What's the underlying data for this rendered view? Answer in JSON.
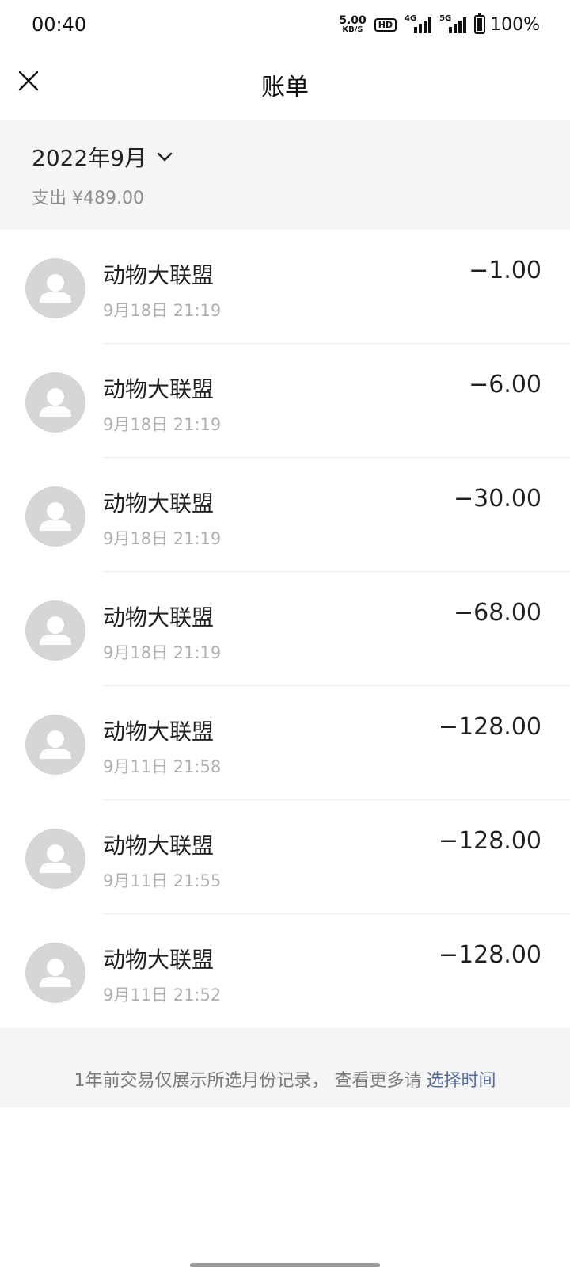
{
  "status_bar": {
    "time": "00:40",
    "net_speed_value": "5.00",
    "net_speed_unit": "KB/S",
    "hd_label": "HD",
    "signal_1_label": "4G",
    "signal_2_label": "5G",
    "battery_text": "100%"
  },
  "header": {
    "title": "账单",
    "close_icon": "close-icon"
  },
  "summary": {
    "month_label": "2022年9月",
    "total_label": "支出 ¥489.00",
    "chevron_icon": "chevron-down-icon"
  },
  "transactions": [
    {
      "merchant": "动物大联盟",
      "time": "9月18日 21:19",
      "amount": "−1.00"
    },
    {
      "merchant": "动物大联盟",
      "time": "9月18日 21:19",
      "amount": "−6.00"
    },
    {
      "merchant": "动物大联盟",
      "time": "9月18日 21:19",
      "amount": "−30.00"
    },
    {
      "merchant": "动物大联盟",
      "time": "9月18日 21:19",
      "amount": "−68.00"
    },
    {
      "merchant": "动物大联盟",
      "time": "9月11日 21:58",
      "amount": "−128.00"
    },
    {
      "merchant": "动物大联盟",
      "time": "9月11日 21:55",
      "amount": "−128.00"
    },
    {
      "merchant": "动物大联盟",
      "time": "9月11日 21:52",
      "amount": "−128.00"
    }
  ],
  "footer": {
    "note": "1年前交易仅展示所选月份记录， 查看更多请",
    "link": "选择时间"
  },
  "colors": {
    "link": "#576b95",
    "summary_bg": "#f5f5f5",
    "avatar_bg": "#d6d6d6"
  }
}
